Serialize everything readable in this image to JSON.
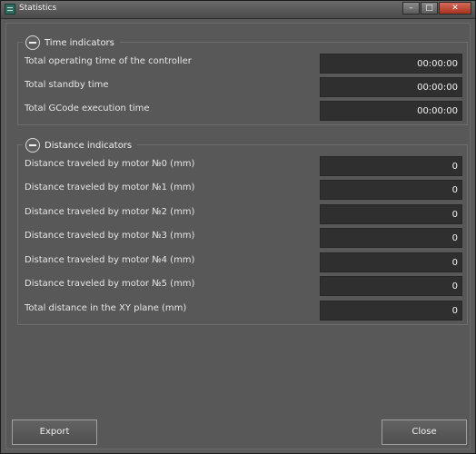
{
  "window": {
    "title": "Statistics",
    "controls": {
      "minimize": "–",
      "maximize": "□",
      "close": "✕"
    }
  },
  "time_group": {
    "title": "Time indicators",
    "rows": [
      {
        "label": "Total operating time of the controller",
        "value": "00:00:00"
      },
      {
        "label": "Total standby time",
        "value": "00:00:00"
      },
      {
        "label": "Total GCode execution time",
        "value": "00:00:00"
      }
    ]
  },
  "distance_group": {
    "title": "Distance indicators",
    "rows": [
      {
        "label": "Distance traveled by motor №0 (mm)",
        "value": "0"
      },
      {
        "label": "Distance traveled by motor №1 (mm)",
        "value": "0"
      },
      {
        "label": "Distance traveled by motor №2 (mm)",
        "value": "0"
      },
      {
        "label": "Distance traveled by motor №3 (mm)",
        "value": "0"
      },
      {
        "label": "Distance traveled by motor №4 (mm)",
        "value": "0"
      },
      {
        "label": "Distance traveled by motor №5 (mm)",
        "value": "0"
      },
      {
        "label": "Total distance in the XY plane (mm)",
        "value": "0"
      }
    ]
  },
  "buttons": {
    "export": "Export",
    "close": "Close"
  }
}
